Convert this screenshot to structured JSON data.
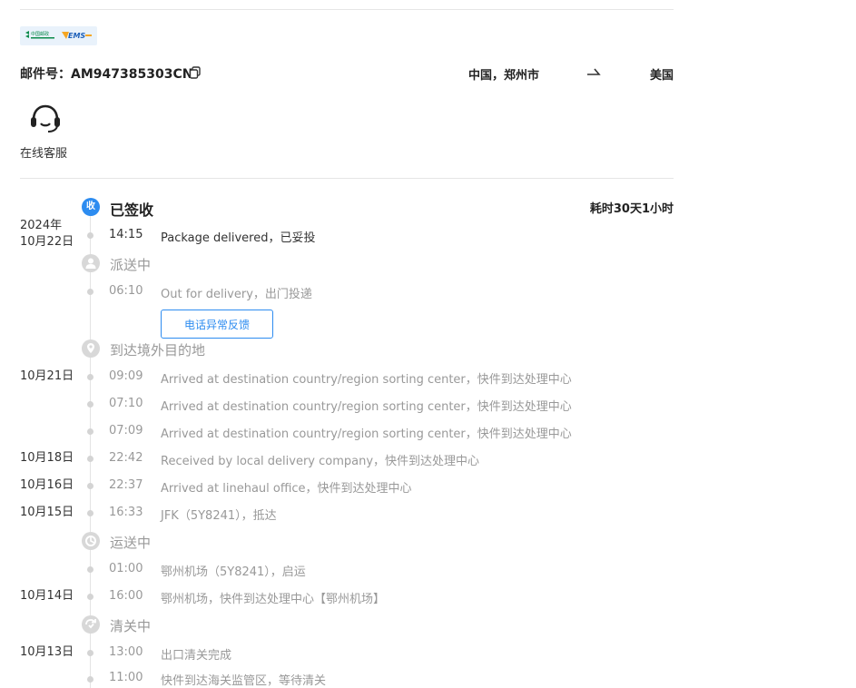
{
  "header": {
    "logo_cp_text": "中国邮政",
    "logo_ems_text": "EMS",
    "tracking_label": "邮件号：",
    "tracking_number": "AM947385303CN",
    "origin": "中国，郑州市",
    "destination": "美国"
  },
  "support": {
    "label": "在线客服"
  },
  "timeline": {
    "duration": "耗时30天1小时",
    "stages": {
      "delivered": {
        "icon_label": "收",
        "title": "已签收"
      },
      "out_for_delivery": {
        "title": "派送中"
      },
      "arrived_dest": {
        "title": "到达境外目的地"
      },
      "in_transit": {
        "title": "运送中"
      },
      "customs": {
        "title": "清关中"
      }
    },
    "dates": {
      "d1": "2024年\n10月22日",
      "d2": "10月21日",
      "d3": "10月18日",
      "d4": "10月16日",
      "d5": "10月15日",
      "d6": "10月14日",
      "d7": "10月13日"
    },
    "events": [
      {
        "time": "14:15",
        "desc": "Package delivered，已妥投"
      },
      {
        "time": "06:10",
        "desc": "Out for delivery，出门投递"
      },
      {
        "time": "09:09",
        "desc": "Arrived at destination country/region sorting center，快件到达处理中心"
      },
      {
        "time": "07:10",
        "desc": "Arrived at destination country/region sorting center，快件到达处理中心"
      },
      {
        "time": "07:09",
        "desc": "Arrived at destination country/region sorting center，快件到达处理中心"
      },
      {
        "time": "22:42",
        "desc": "Received by local delivery company，快件到达处理中心"
      },
      {
        "time": "22:37",
        "desc": "Arrived at linehaul office，快件到达处理中心"
      },
      {
        "time": "16:33",
        "desc": "JFK（5Y8241），抵达"
      },
      {
        "time": "01:00",
        "desc": "鄂州机场（5Y8241），启运"
      },
      {
        "time": "16:00",
        "desc": "鄂州机场，快件到达处理中心【鄂州机场】"
      },
      {
        "time": "13:00",
        "desc": "出口清关完成"
      },
      {
        "time": "11:00",
        "desc": "快件到达海关监管区，等待清关"
      }
    ],
    "feedback_button": "电话异常反馈"
  },
  "colors": {
    "accent": "#2d8cf0",
    "muted": "#999999",
    "text": "#333333"
  }
}
